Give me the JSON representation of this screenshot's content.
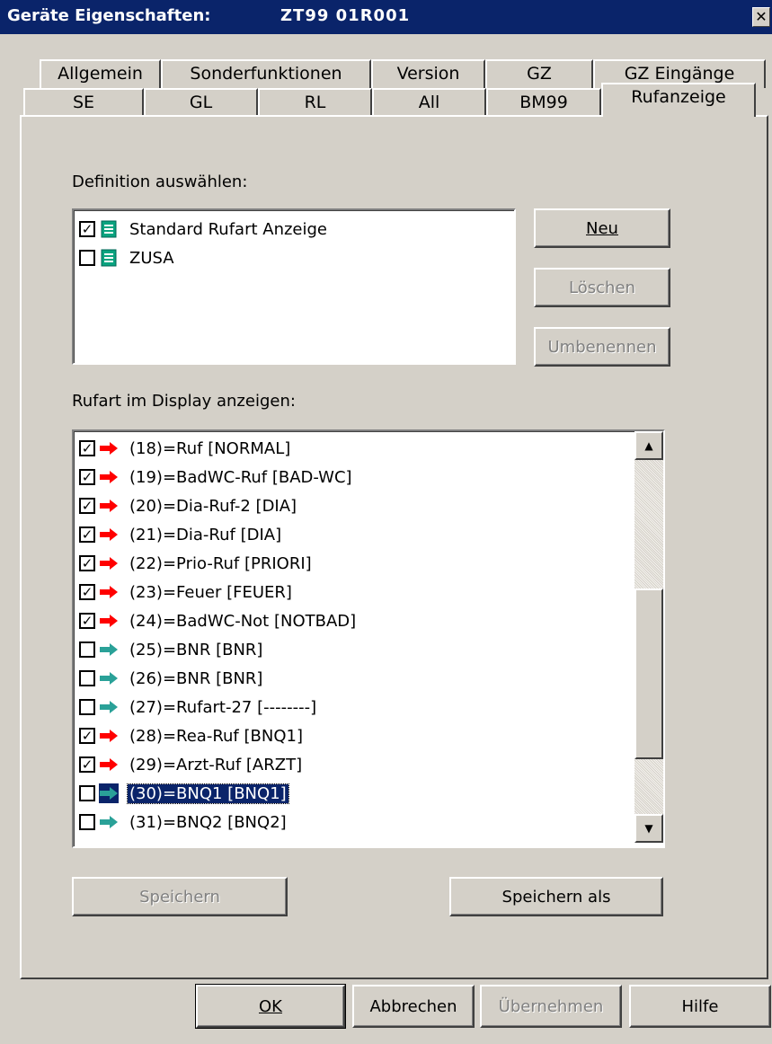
{
  "window": {
    "title": "Geräte Eigenschaften:",
    "device": "ZT99  01R001",
    "close_glyph": "✕"
  },
  "tabs": {
    "row1": [
      "Allgemein",
      "Sonderfunktionen",
      "Version",
      "GZ",
      "GZ Eingänge"
    ],
    "row2": [
      "SE",
      "GL",
      "RL",
      "All",
      "BM99",
      "Rufanzeige"
    ],
    "active": "Rufanzeige"
  },
  "definition": {
    "label": "Definition auswählen:",
    "items": [
      {
        "label": "Standard Rufart Anzeige",
        "checked": true,
        "icon": "document-icon"
      },
      {
        "label": "ZUSA",
        "checked": false,
        "icon": "document-icon"
      }
    ],
    "buttons": {
      "new": "Neu",
      "delete": "Löschen",
      "rename": "Umbenennen"
    }
  },
  "display": {
    "label": "Rufart im Display anzeigen:",
    "items": [
      {
        "label": "(18)=Ruf [NORMAL]",
        "checked": true,
        "color": "#ff0000"
      },
      {
        "label": "(19)=BadWC-Ruf [BAD-WC]",
        "checked": true,
        "color": "#ff0000"
      },
      {
        "label": "(20)=Dia-Ruf-2 [DIA]",
        "checked": true,
        "color": "#ff0000"
      },
      {
        "label": "(21)=Dia-Ruf [DIA]",
        "checked": true,
        "color": "#ff0000"
      },
      {
        "label": "(22)=Prio-Ruf [PRIORI]",
        "checked": true,
        "color": "#ff0000"
      },
      {
        "label": "(23)=Feuer [FEUER]",
        "checked": true,
        "color": "#ff0000"
      },
      {
        "label": "(24)=BadWC-Not [NOTBAD]",
        "checked": true,
        "color": "#ff0000"
      },
      {
        "label": "(25)=BNR [BNR]",
        "checked": false,
        "color": "#2aa198"
      },
      {
        "label": "(26)=BNR [BNR]",
        "checked": false,
        "color": "#2aa198"
      },
      {
        "label": "(27)=Rufart-27 [--------]",
        "checked": false,
        "color": "#2aa198"
      },
      {
        "label": "(28)=Rea-Ruf [BNQ1]",
        "checked": true,
        "color": "#ff0000"
      },
      {
        "label": "(29)=Arzt-Ruf [ARZT]",
        "checked": true,
        "color": "#ff0000"
      },
      {
        "label": "(30)=BNQ1 [BNQ1]",
        "checked": false,
        "color": "#2aa198",
        "selected": true
      },
      {
        "label": "(31)=BNQ2 [BNQ2]",
        "checked": false,
        "color": "#2aa198"
      }
    ],
    "buttons": {
      "save": "Speichern",
      "save_as": "Speichern als"
    }
  },
  "footer": {
    "ok": "OK",
    "cancel": "Abbrechen",
    "apply": "Übernehmen",
    "help": "Hilfe"
  },
  "scrollbar": {
    "position": 0.7
  }
}
